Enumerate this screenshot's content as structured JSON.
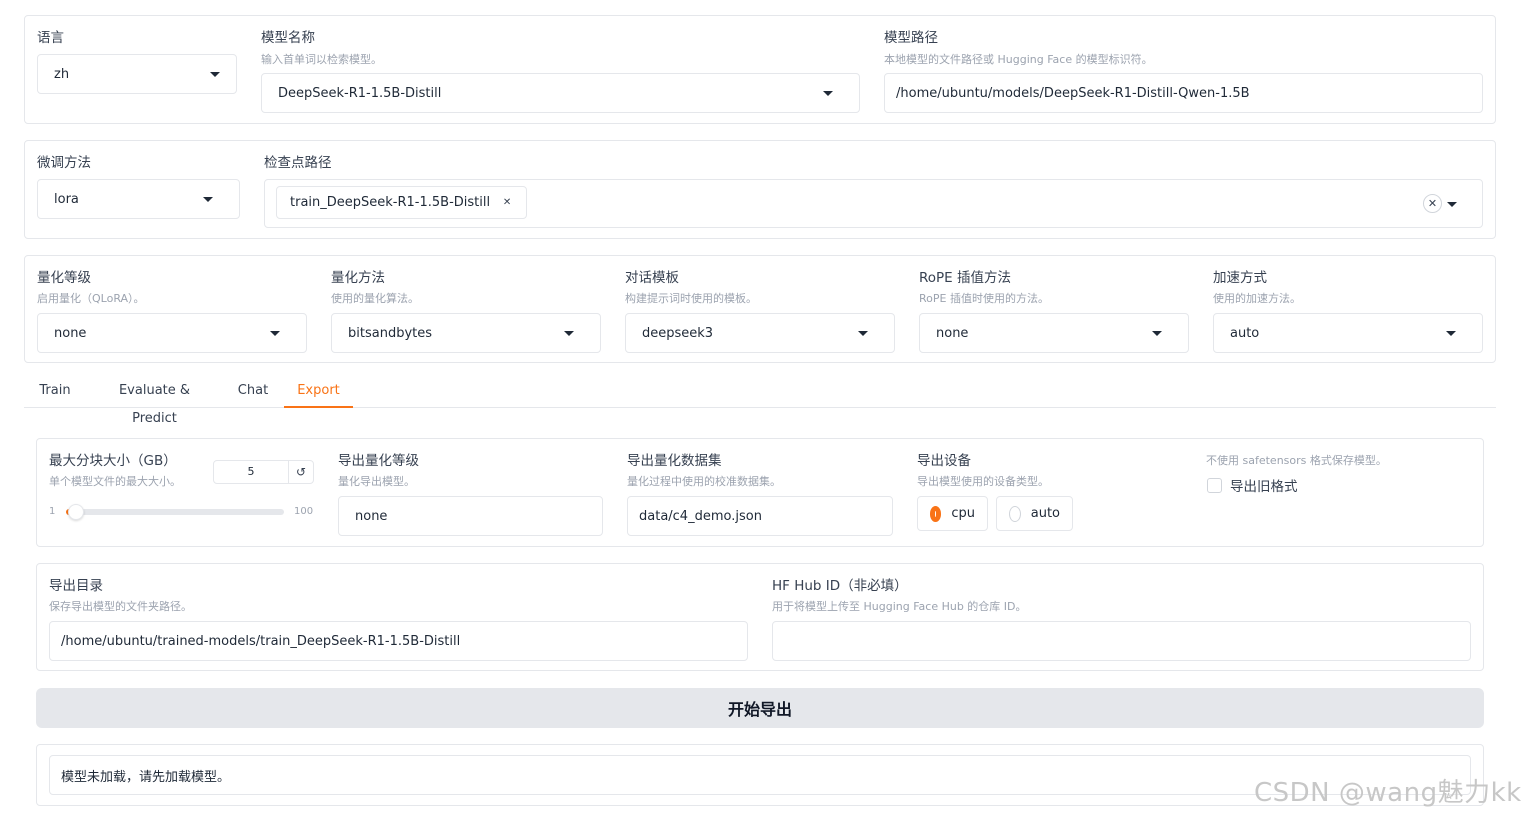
{
  "top": {
    "lang_label": "语言",
    "lang_value": "zh",
    "model_name_label": "模型名称",
    "model_name_info": "输入首单词以检索模型。",
    "model_name_value": "DeepSeek-R1-1.5B-Distill",
    "model_path_label": "模型路径",
    "model_path_info": "本地模型的文件路径或 Hugging Face 的模型标识符。",
    "model_path_value": "/home/ubuntu/models/DeepSeek-R1-Distill-Qwen-1.5B"
  },
  "finetune": {
    "method_label": "微调方法",
    "method_value": "lora",
    "checkpoint_label": "检查点路径",
    "checkpoint_chip": "train_DeepSeek-R1-1.5B-Distill"
  },
  "advanced": {
    "quant_bit_label": "量化等级",
    "quant_bit_info": "启用量化（QLoRA）。",
    "quant_bit_value": "none",
    "quant_method_label": "量化方法",
    "quant_method_info": "使用的量化算法。",
    "quant_method_value": "bitsandbytes",
    "template_label": "对话模板",
    "template_info": "构建提示词时使用的模板。",
    "template_value": "deepseek3",
    "rope_label": "RoPE 插值方法",
    "rope_info": "RoPE 插值时使用的方法。",
    "rope_value": "none",
    "booster_label": "加速方式",
    "booster_info": "使用的加速方法。",
    "booster_value": "auto"
  },
  "tabs": [
    {
      "label": "Train"
    },
    {
      "label": "Evaluate & Predict"
    },
    {
      "label": "Chat"
    },
    {
      "label": "Export",
      "active": true
    }
  ],
  "export": {
    "shard_label": "最大分块大小（GB）",
    "shard_info": "单个模型文件的最大大小。",
    "shard_value": "5",
    "reset_icon": "↺",
    "shard_min": "1",
    "shard_max": "100",
    "shard_fraction": 0.04,
    "quant_bit_label": "导出量化等级",
    "quant_bit_info": "量化导出模型。",
    "quant_bit_value": "none",
    "quant_dataset_label": "导出量化数据集",
    "quant_dataset_info": "量化过程中使用的校准数据集。",
    "quant_dataset_value": "data/c4_demo.json",
    "device_label": "导出设备",
    "device_info": "导出模型使用的设备类型。",
    "device_options": [
      {
        "label": "cpu",
        "selected": true
      },
      {
        "label": "auto",
        "selected": false
      }
    ],
    "legacy_info": "不使用 safetensors 格式保存模型。",
    "legacy_label": "导出旧格式",
    "legacy_checked": false,
    "dir_label": "导出目录",
    "dir_info": "保存导出模型的文件夹路径。",
    "dir_value": "/home/ubuntu/trained-models/train_DeepSeek-R1-1.5B-Distill",
    "hub_label": "HF Hub ID（非必填）",
    "hub_info": "用于将模型上传至 Hugging Face Hub 的仓库 ID。",
    "hub_value": "",
    "button_label": "开始导出",
    "output_text": "模型未加载，请先加载模型。"
  },
  "watermark": "CSDN @wang魅力kk",
  "colors": {
    "accent": "#f97316",
    "border": "#e5e7eb",
    "button_bg": "#e5e7eb",
    "info_text": "#9ca3af"
  }
}
